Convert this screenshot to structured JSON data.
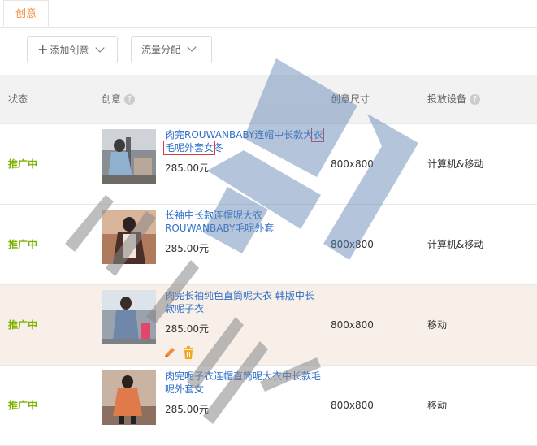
{
  "tabs": {
    "active": "创意"
  },
  "toolbar": {
    "add_label": "添加创意",
    "flow_label": "流量分配"
  },
  "columns": {
    "status": "状态",
    "creative": "创意",
    "size": "创意尺寸",
    "device": "投放设备",
    "help": "?"
  },
  "rows": [
    {
      "status": "推广中",
      "title_pre": "肉完ROUWANBABY连帽中长款大",
      "title_boxed": "衣毛呢外套女",
      "title_post": "冬",
      "price": "285.00元",
      "size": "800x800",
      "device": "计算机&移动"
    },
    {
      "status": "推广中",
      "title": "长袖中长款连帽呢大衣ROUWANBABY毛呢外套",
      "price": "285.00元",
      "size": "800x800",
      "device": "计算机&移动"
    },
    {
      "status": "推广中",
      "title": "肉完长袖纯色直筒呢大衣 韩版中长款呢子衣",
      "price": "285.00元",
      "size": "800x800",
      "device": "移动"
    },
    {
      "status": "推广中",
      "title": "肉完呢子衣连帽直筒呢大衣中长款毛呢外套女",
      "price": "285.00元",
      "size": "800x800",
      "device": "移动"
    }
  ],
  "colors": {
    "accent": "#f08c3a",
    "status": "#7cb305",
    "link": "#2f6fc9",
    "highlight_row": "#f8f0e8",
    "edit_icon": "#f08c3a",
    "delete_icon": "#f5a623"
  }
}
